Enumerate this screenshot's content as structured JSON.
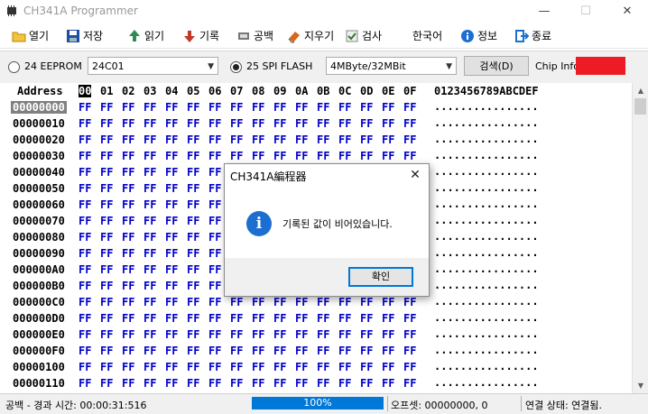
{
  "window": {
    "title": "CH341A Programmer",
    "minimize": "—",
    "maximize": "☐",
    "close": "✕"
  },
  "toolbar": {
    "open": "열기",
    "save": "저장",
    "read": "읽기",
    "write": "기록",
    "blank": "공백",
    "erase": "지우기",
    "verify": "검사",
    "language": "한국어",
    "info": "정보",
    "exit": "종료"
  },
  "options": {
    "eeprom_label": "24 EEPROM",
    "eeprom_value": "24C01",
    "eeprom_selected": false,
    "spi_label": "25 SPI FLASH",
    "spi_value": "4MByte/32MBit",
    "spi_selected": true,
    "detect_label": "검색(D)",
    "chip_info_label": "Chip Info:",
    "chip_info_color": "#ed1c24"
  },
  "hex": {
    "address_header": "Address",
    "columns": [
      "00",
      "01",
      "02",
      "03",
      "04",
      "05",
      "06",
      "07",
      "08",
      "09",
      "0A",
      "0B",
      "0C",
      "0D",
      "0E",
      "0F"
    ],
    "ascii_header": "0123456789ABCDEF",
    "byte_value": "FF",
    "ascii_row": "................",
    "selected_address": "00000000",
    "rows": [
      "00000000",
      "00000010",
      "00000020",
      "00000030",
      "00000040",
      "00000050",
      "00000060",
      "00000070",
      "00000080",
      "00000090",
      "000000A0",
      "000000B0",
      "000000C0",
      "000000D0",
      "000000E0",
      "000000F0",
      "00000100",
      "00000110"
    ]
  },
  "status": {
    "elapsed": "공백 - 경과 시간: 00:00:31:516",
    "progress_text": "100%",
    "progress": 1.0,
    "offset": "오프셋: 00000000, 0",
    "connection": "연결 상태: 연결됨."
  },
  "dialog": {
    "title": "CH341A編程器",
    "message": "기록된 값이 비어있습니다.",
    "ok": "확인",
    "close": "✕",
    "info_glyph": "i"
  },
  "colors": {
    "hex_byte": "#0000c8",
    "progress": "#0078d7",
    "accent": "#0078d7"
  }
}
